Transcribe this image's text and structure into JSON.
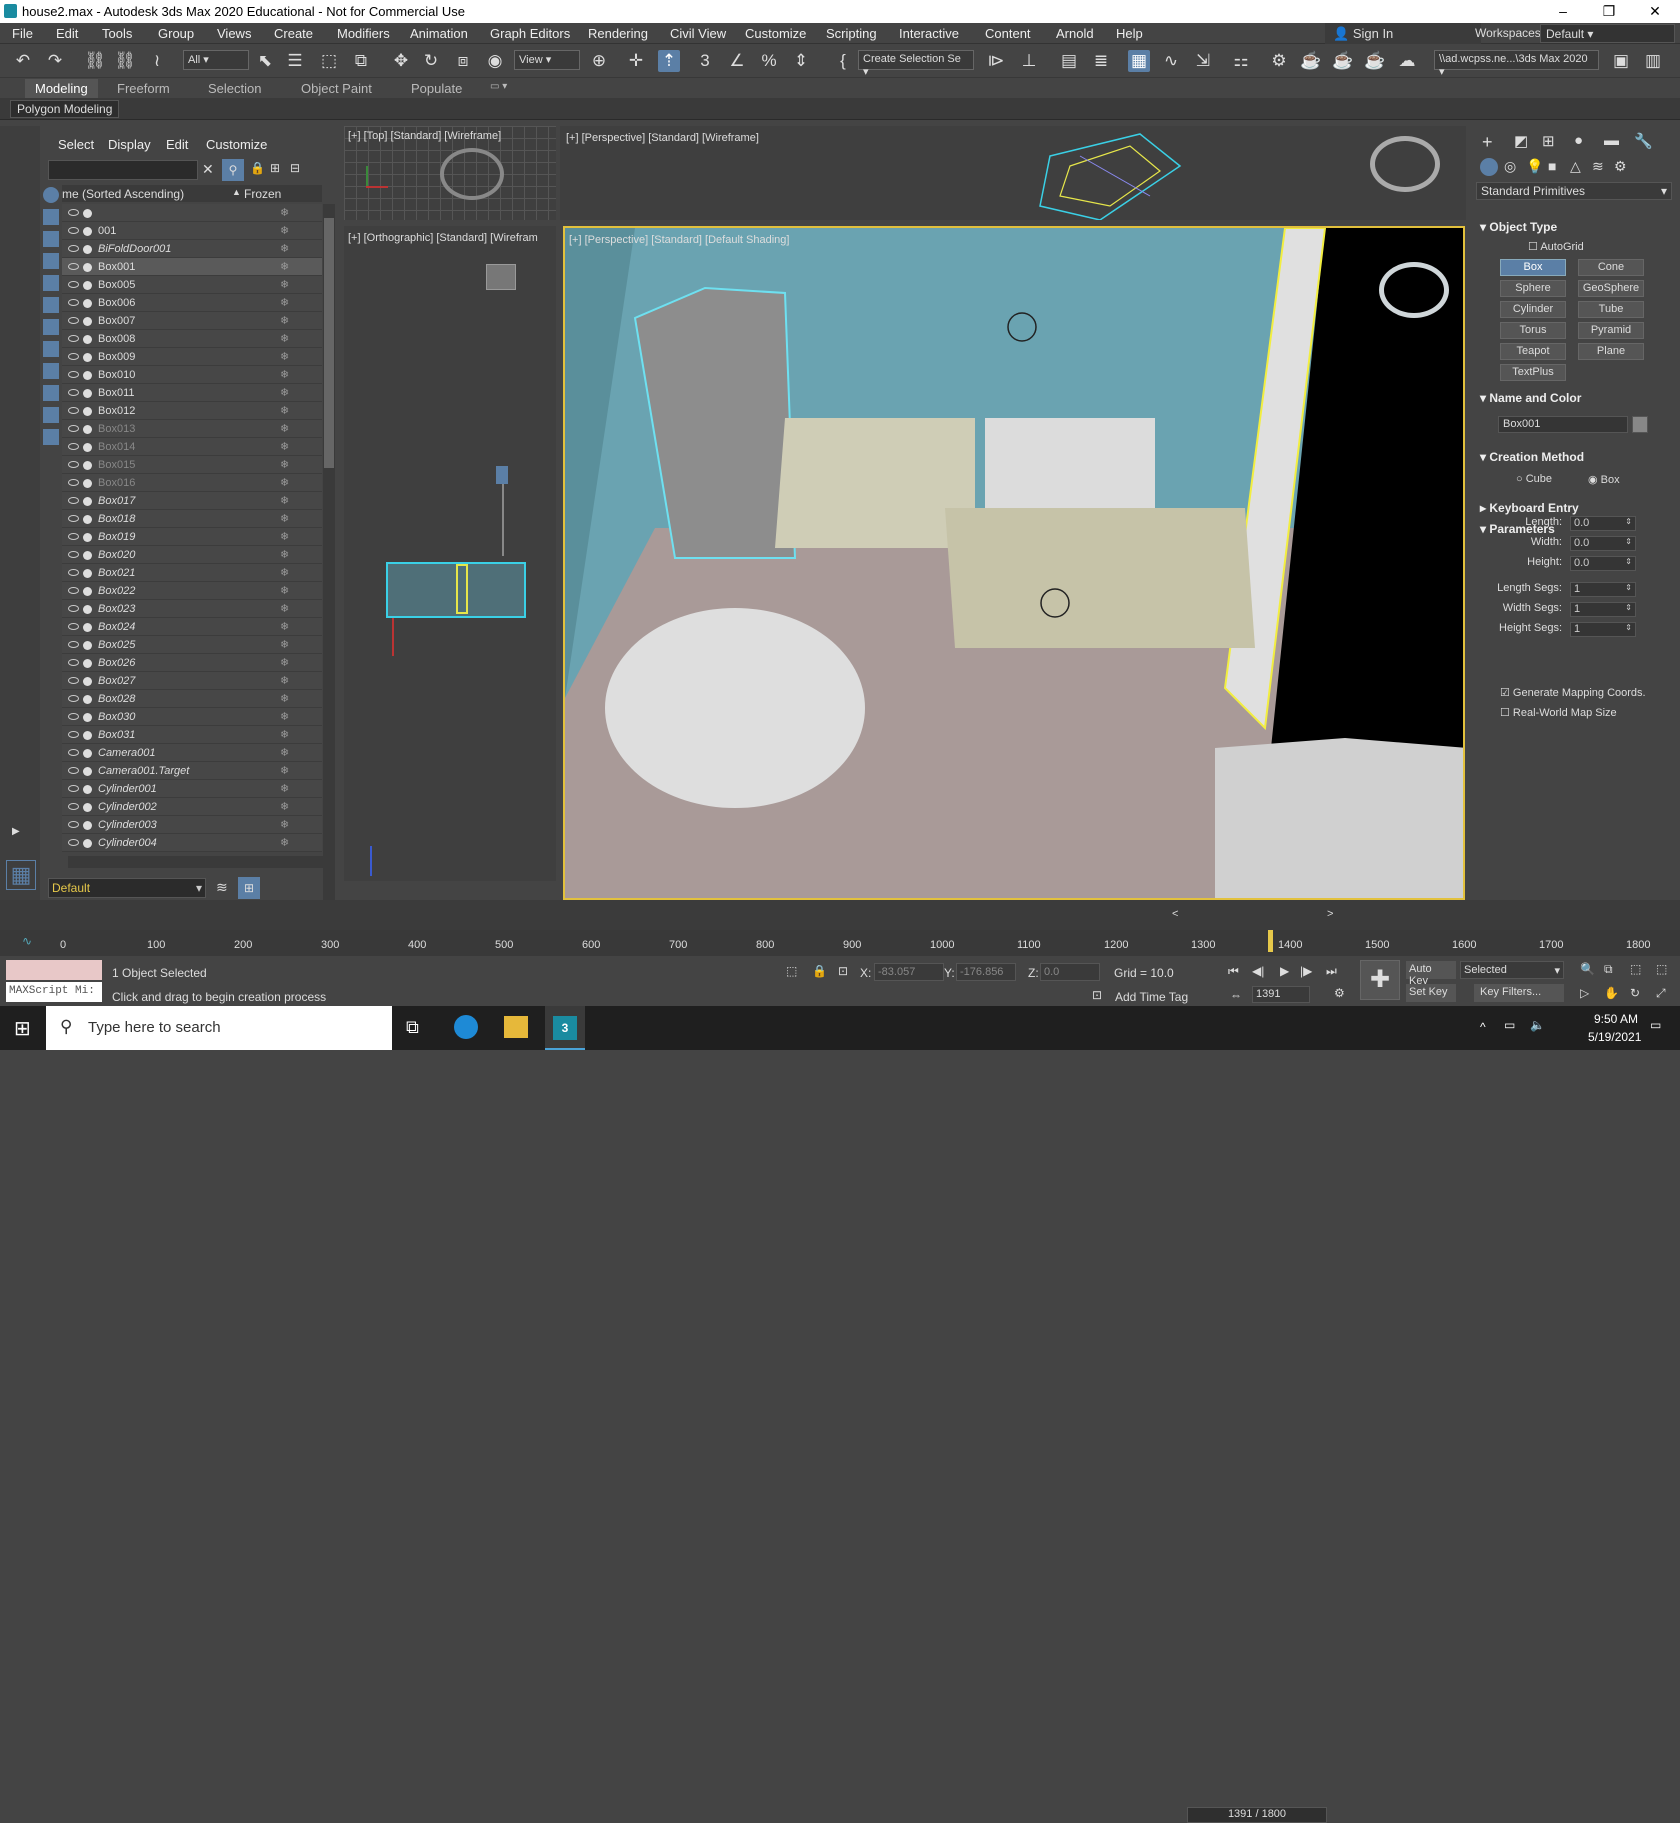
{
  "window": {
    "title": "house2.max - Autodesk 3ds Max 2020 Educational - Not for Commercial Use",
    "minimize": "–",
    "maximize": "❐",
    "close": "✕"
  },
  "menu": [
    "File",
    "Edit",
    "Tools",
    "Group",
    "Views",
    "Create",
    "Modifiers",
    "Animation",
    "Graph Editors",
    "Rendering",
    "Civil View",
    "Customize",
    "Scripting",
    "Interactive",
    "Content",
    "Arnold",
    "Help"
  ],
  "signin": "Sign In",
  "workspaces_label": "Workspaces:",
  "workspace": "Default",
  "toolbar": {
    "filter": "All",
    "refcoord": "View",
    "selset": "Create Selection Se",
    "path": "\\\\ad.wcpss.ne...\\3ds Max 2020"
  },
  "ribbon": {
    "tabs": [
      "Modeling",
      "Freeform",
      "Selection",
      "Object Paint",
      "Populate"
    ],
    "panel": "Polygon Modeling"
  },
  "scene": {
    "menu": [
      "Select",
      "Display",
      "Edit",
      "Customize"
    ],
    "col_name": "me (Sorted Ascending)",
    "col_frozen": "Frozen",
    "rows": [
      {
        "n": "",
        "s": "n"
      },
      {
        "n": "001",
        "s": "n"
      },
      {
        "n": "BiFoldDoor001",
        "s": "i"
      },
      {
        "n": "Box001",
        "s": "sel"
      },
      {
        "n": "Box005",
        "s": "n"
      },
      {
        "n": "Box006",
        "s": "n"
      },
      {
        "n": "Box007",
        "s": "n"
      },
      {
        "n": "Box008",
        "s": "n"
      },
      {
        "n": "Box009",
        "s": "n"
      },
      {
        "n": "Box010",
        "s": "n"
      },
      {
        "n": "Box011",
        "s": "n"
      },
      {
        "n": "Box012",
        "s": "n"
      },
      {
        "n": "Box013",
        "s": "d"
      },
      {
        "n": "Box014",
        "s": "d"
      },
      {
        "n": "Box015",
        "s": "d"
      },
      {
        "n": "Box016",
        "s": "d"
      },
      {
        "n": "Box017",
        "s": "i"
      },
      {
        "n": "Box018",
        "s": "i"
      },
      {
        "n": "Box019",
        "s": "i"
      },
      {
        "n": "Box020",
        "s": "i"
      },
      {
        "n": "Box021",
        "s": "i"
      },
      {
        "n": "Box022",
        "s": "i"
      },
      {
        "n": "Box023",
        "s": "i"
      },
      {
        "n": "Box024",
        "s": "i"
      },
      {
        "n": "Box025",
        "s": "i"
      },
      {
        "n": "Box026",
        "s": "i"
      },
      {
        "n": "Box027",
        "s": "i"
      },
      {
        "n": "Box028",
        "s": "i"
      },
      {
        "n": "Box030",
        "s": "i"
      },
      {
        "n": "Box031",
        "s": "i"
      },
      {
        "n": "Camera001",
        "s": "i"
      },
      {
        "n": "Camera001.Target",
        "s": "i"
      },
      {
        "n": "Cylinder001",
        "s": "i"
      },
      {
        "n": "Cylinder002",
        "s": "i"
      },
      {
        "n": "Cylinder003",
        "s": "i"
      },
      {
        "n": "Cylinder004",
        "s": "i"
      }
    ],
    "layer": "Default"
  },
  "viewports": {
    "top": "[+] [Top] [Standard] [Wireframe]",
    "persp1": "[+] [Perspective] [Standard] [Wireframe]",
    "ortho": "[+] [Orthographic] [Standard] [Wirefram",
    "main": "[+] [Perspective] [Standard] [Default Shading]"
  },
  "cmd": {
    "dropdown": "Standard Primitives",
    "object_type": "Object Type",
    "autogrid": "AutoGrid",
    "prims": [
      "Box",
      "Cone",
      "Sphere",
      "GeoSphere",
      "Cylinder",
      "Tube",
      "Torus",
      "Pyramid",
      "Teapot",
      "Plane",
      "TextPlus"
    ],
    "name_color": "Name and Color",
    "obj_name": "Box001",
    "creation": "Creation Method",
    "cube": "Cube",
    "box": "Box",
    "kbd": "Keyboard Entry",
    "params": "Parameters",
    "fields": [
      {
        "l": "Length:",
        "v": "0.0"
      },
      {
        "l": "Width:",
        "v": "0.0"
      },
      {
        "l": "Height:",
        "v": "0.0"
      },
      {
        "l": "Length Segs:",
        "v": "1"
      },
      {
        "l": "Width Segs:",
        "v": "1"
      },
      {
        "l": "Height Segs:",
        "v": "1"
      }
    ],
    "gen_map": "Generate Mapping Coords.",
    "real_world": "Real-World Map Size"
  },
  "time": {
    "frame": "1391 / 1800",
    "ticks": [
      "0",
      "100",
      "200",
      "300",
      "400",
      "500",
      "600",
      "700",
      "800",
      "900",
      "1000",
      "1100",
      "1200",
      "1300",
      "1400",
      "1500",
      "1600",
      "1700",
      "1800"
    ]
  },
  "status": {
    "selected": "1 Object Selected",
    "prompt": "Click and drag to begin creation process",
    "maxscript": "MAXScript Mi:",
    "x_label": "X:",
    "x": "-83.057",
    "y_label": "Y:",
    "y": "-176.856",
    "z_label": "Z:",
    "z": "0.0",
    "grid": "Grid = 10.0",
    "addtime": "Add Time Tag",
    "autokey": "Auto Key",
    "setkey": "Set Key",
    "selmode": "Selected",
    "keyfilters": "Key Filters...",
    "curframe": "1391"
  },
  "taskbar": {
    "search": "Type here to search",
    "time": "9:50 AM",
    "date": "5/19/2021"
  }
}
